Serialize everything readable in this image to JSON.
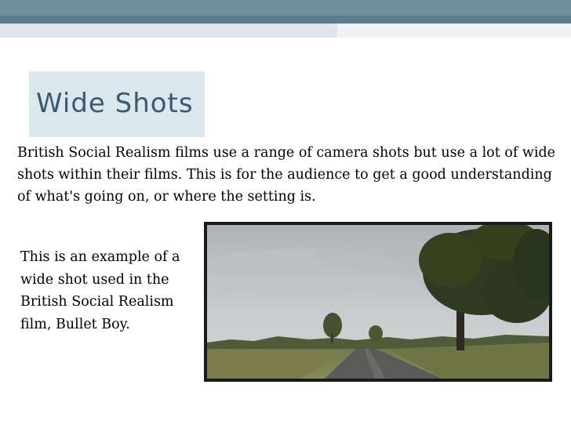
{
  "slide": {
    "title": "Wide Shots",
    "body": "British Social Realism films use a range of camera shots but use a lot of wide shots within their films. This is for the audience to get a good understanding of what's going on, or where the setting is.",
    "caption": "This is an example of a wide shot used in the British Social Realism film, Bullet Boy."
  },
  "colors": {
    "header_band": "#6f8e9c",
    "title_box": "#dbe7ef",
    "title_text": "#3b5a6a"
  }
}
